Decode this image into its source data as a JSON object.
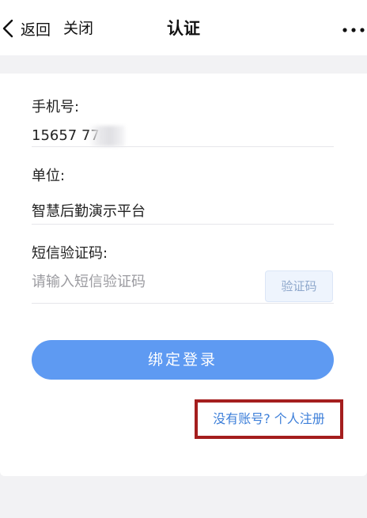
{
  "nav": {
    "back_label": "返回",
    "close_label": "关闭",
    "title": "认证"
  },
  "form": {
    "phone_label": "手机号:",
    "phone_value": "15657      778",
    "unit_label": "单位:",
    "unit_value": "智慧后勤演示平台",
    "sms_label": "短信验证码:",
    "sms_value": "",
    "sms_placeholder": "请输入短信验证码",
    "code_button_label": "验证码",
    "login_button_label": "绑定登录",
    "register_link_label": "没有账号? 个人注册"
  },
  "colors": {
    "accent": "#5e9af2",
    "link": "#3d7fd9",
    "highlight_border": "#a41e1e"
  }
}
